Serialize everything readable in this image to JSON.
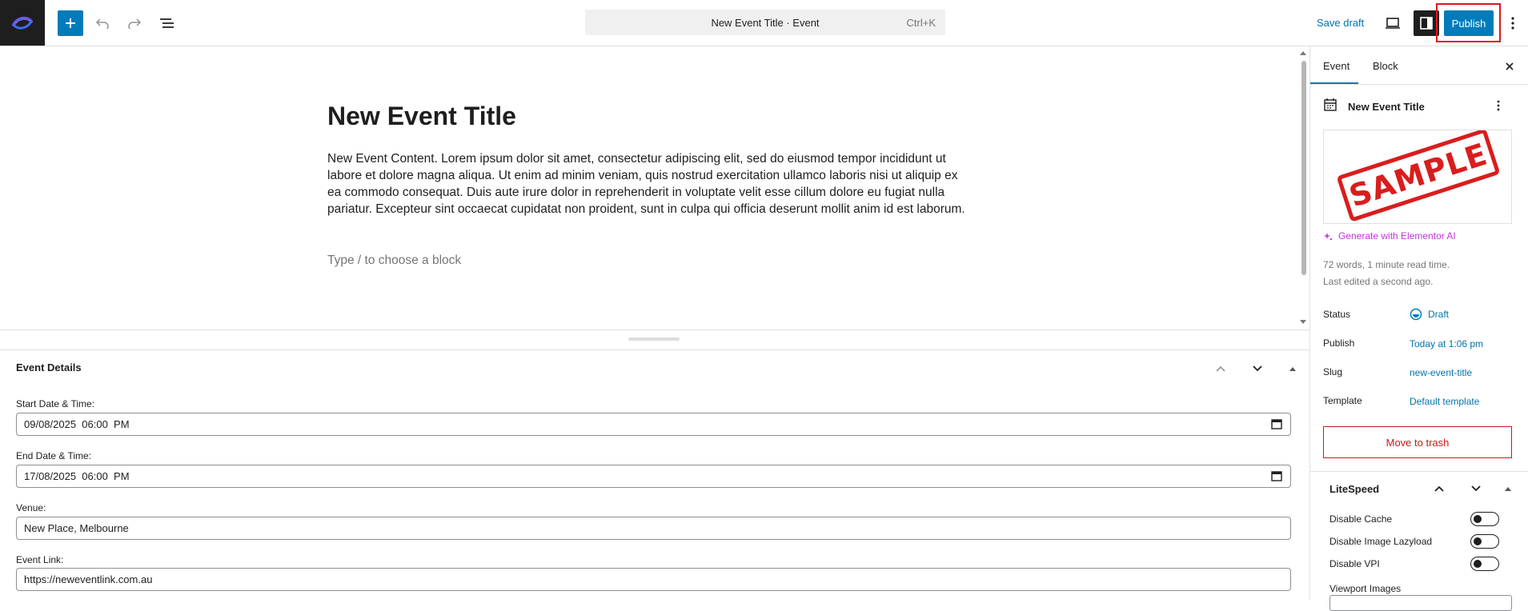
{
  "toolbar": {
    "document_title": "New Event Title · Event",
    "shortcut": "Ctrl+K",
    "save_draft": "Save draft",
    "publish": "Publish"
  },
  "editor": {
    "title": "New Event Title",
    "content": "New Event Content. Lorem ipsum dolor sit amet, consectetur adipiscing elit, sed do eiusmod tempor incididunt ut labore et dolore magna aliqua. Ut enim ad minim veniam, quis nostrud exercitation ullamco laboris nisi ut aliquip ex ea commodo consequat. Duis aute irure dolor in reprehenderit in voluptate velit esse cillum dolore eu fugiat nulla pariatur. Excepteur sint occaecat cupidatat non proident, sunt in culpa qui officia deserunt mollit anim id est laborum.",
    "block_placeholder": "Type / to choose a block"
  },
  "event_details": {
    "title": "Event Details",
    "start_label": "Start Date & Time:",
    "start_value": "09/08/2025  06:00  PM",
    "end_label": "End Date & Time:",
    "end_value": "17/08/2025  06:00  PM",
    "venue_label": "Venue:",
    "venue_value": "New Place, Melbourne",
    "link_label": "Event Link:",
    "link_value": "https://neweventlink.com.au"
  },
  "sidebar": {
    "tabs": [
      "Event",
      "Block"
    ],
    "post_title": "New Event Title",
    "image_text": "SAMPLE",
    "ai_link": "Generate with Elementor AI",
    "word_count": "72 words, 1 minute read time.",
    "last_edited": "Last edited a second ago.",
    "status_label": "Status",
    "status_value": "Draft",
    "publish_label": "Publish",
    "publish_value": "Today at 1:06 pm",
    "slug_label": "Slug",
    "slug_value": "new-event-title",
    "template_label": "Template",
    "template_value": "Default template",
    "trash": "Move to trash",
    "litespeed": {
      "title": "LiteSpeed",
      "options": [
        "Disable Cache",
        "Disable Image Lazyload",
        "Disable VPI"
      ],
      "viewport_label": "Viewport Images"
    }
  },
  "colors": {
    "accent": "#007cba",
    "danger": "#cc1818",
    "ai": "#c036d8",
    "highlight": "#e0141e"
  }
}
